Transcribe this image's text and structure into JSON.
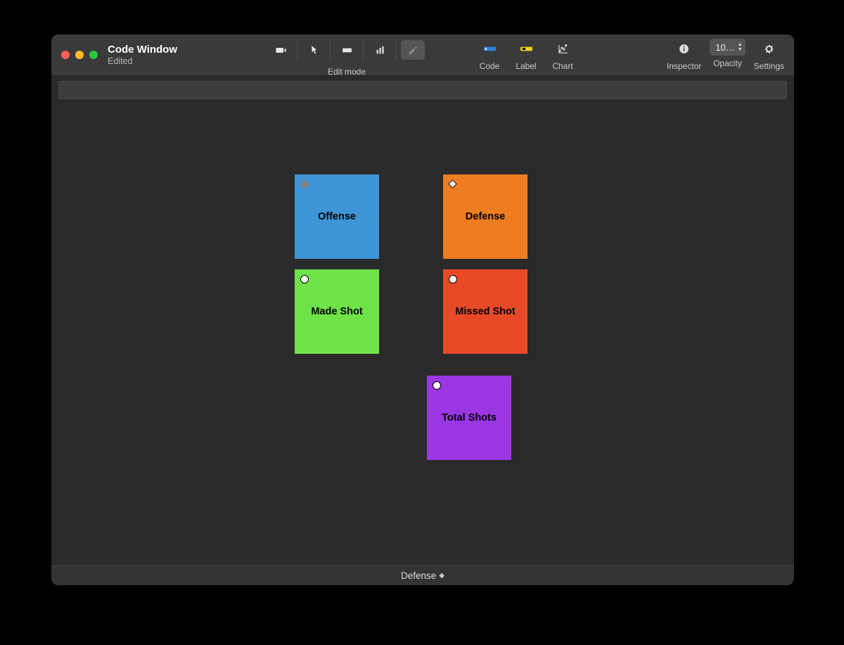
{
  "window": {
    "title": "Code Window",
    "subtitle": "Edited"
  },
  "toolbar": {
    "mode_label": "Edit mode",
    "types": {
      "code": "Code",
      "label": "Label",
      "chart": "Chart"
    },
    "right": {
      "inspector": "Inspector",
      "opacity_label": "Opacity",
      "opacity_value": "10…",
      "settings": "Settings"
    }
  },
  "nodes": {
    "offense": {
      "label": "Offense",
      "color": "#3d95d7"
    },
    "defense": {
      "label": "Defense",
      "color": "#ee7d21"
    },
    "made_shot": {
      "label": "Made Shot",
      "color": "#6fe248"
    },
    "missed_shot": {
      "label": "Missed Shot",
      "color": "#e84a28"
    },
    "total_shots": {
      "label": "Total Shots",
      "color": "#9a37e2"
    }
  },
  "footer": {
    "label": "Defense"
  }
}
